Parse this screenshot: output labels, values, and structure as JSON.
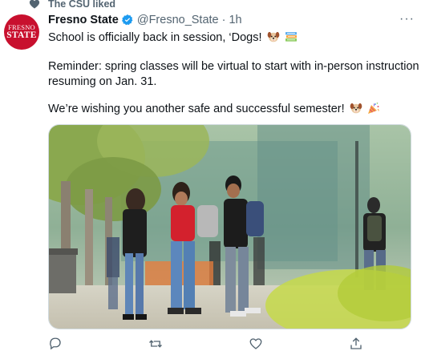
{
  "social_context": {
    "icon": "heart-icon",
    "text": "The CSU liked"
  },
  "tweet": {
    "author": {
      "avatar_line1": "FRESNO",
      "avatar_line2": "STATE",
      "display_name": "Fresno State",
      "verified_icon": "verified-badge-icon",
      "handle": "@Fresno_State",
      "separator": "·",
      "time": "1h"
    },
    "more_icon": "more-options-icon",
    "text": {
      "line1": "School is officially back in session, ‘Dogs!",
      "line2": "Reminder: spring classes will be virtual to start with in-person instruction",
      "line3": "resuming on Jan. 31.",
      "line4": "We’re wishing you another safe and successful semester!"
    },
    "emojis": [
      "dog-face-emoji",
      "books-emoji",
      "dog-face-emoji",
      "party-popper-emoji"
    ],
    "media": {
      "type": "photo",
      "description_icon": "campus-students-photo"
    },
    "actions": [
      "reply-icon",
      "retweet-icon",
      "like-icon",
      "share-icon"
    ]
  },
  "colors": {
    "text_primary": "#0f1419",
    "text_secondary": "#536471",
    "verified_blue": "#1d9bf0",
    "brand_red": "#c8102e"
  }
}
